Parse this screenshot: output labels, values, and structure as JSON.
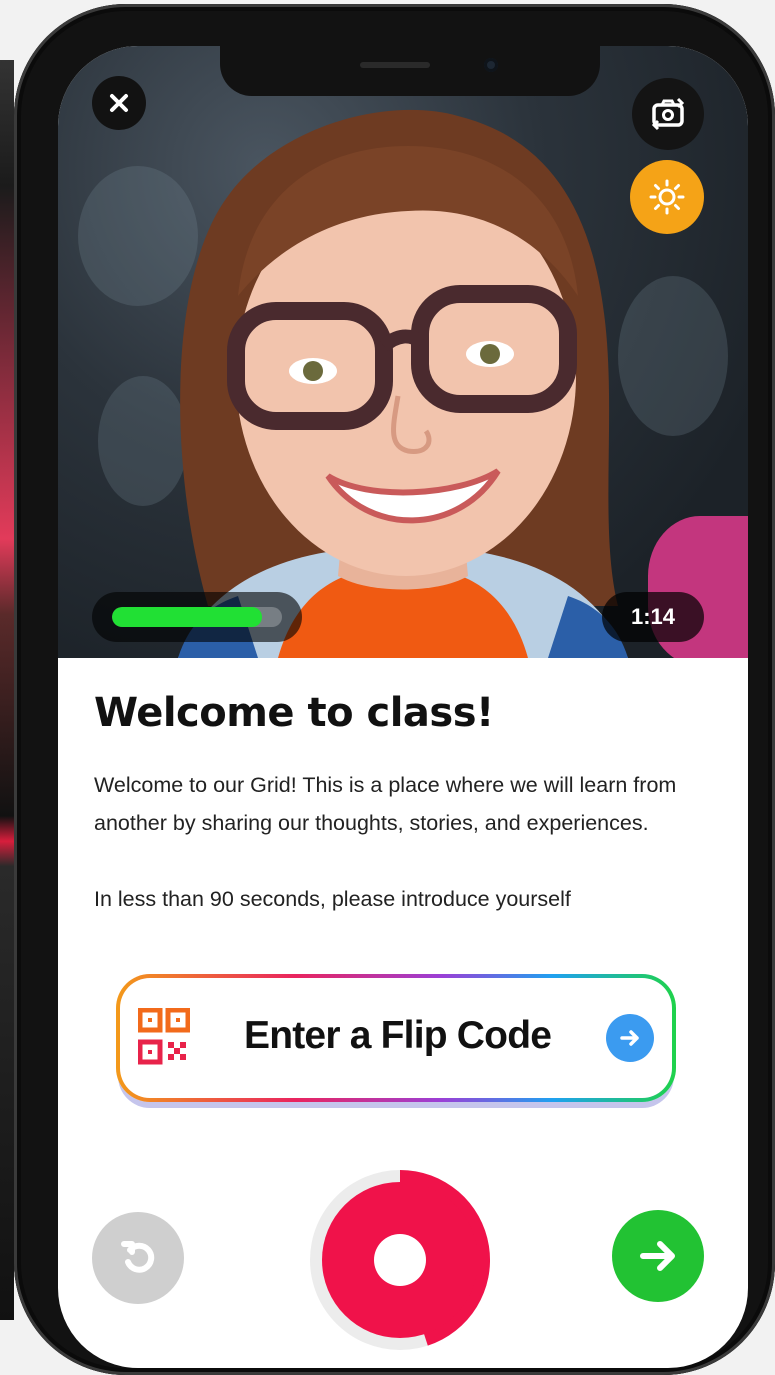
{
  "camera": {
    "progress_fraction": 0.88,
    "timer": "1:14"
  },
  "content": {
    "title": "Welcome to class!",
    "paragraph1": "Welcome to our Grid! This is a place where we will learn from another by sharing our thoughts, stories, and experiences.",
    "paragraph2": "In less than 90 seconds, please introduce yourself"
  },
  "flip_code": {
    "label": "Enter a Flip Code"
  },
  "controls": {
    "record_progress_fraction": 0.45
  },
  "colors": {
    "brightness": "#f5a317",
    "progress": "#21e034",
    "record": "#f0124a",
    "next": "#22c233",
    "arrow": "#3b9bf0"
  },
  "icons": {
    "close": "close-icon",
    "flip_camera": "flip-camera-icon",
    "brightness": "brightness-icon",
    "qr": "qr-code-icon",
    "arrow": "arrow-right-icon",
    "retake": "retake-icon",
    "record": "record-icon",
    "next": "next-arrow-icon"
  }
}
